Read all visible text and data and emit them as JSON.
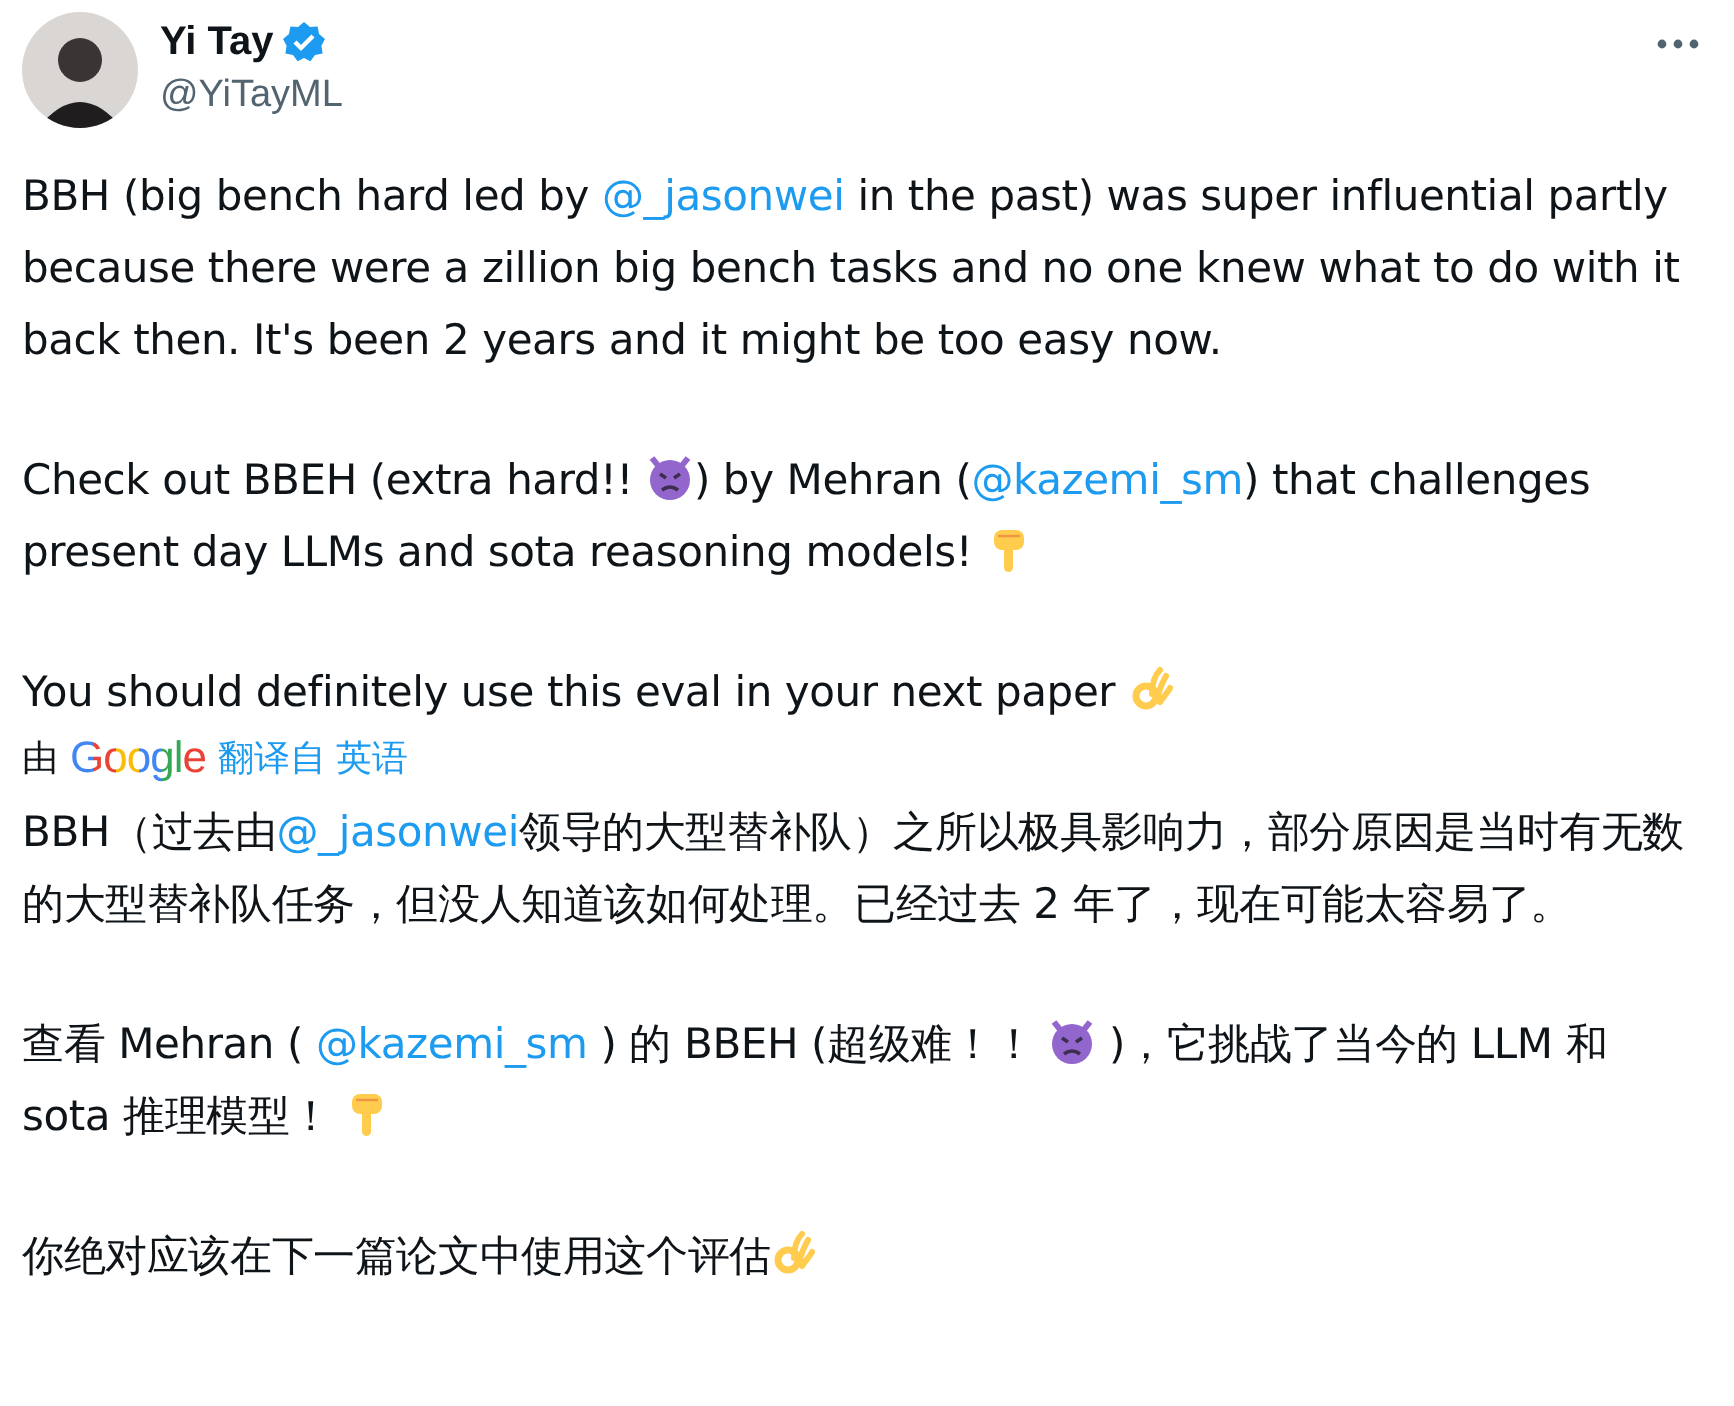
{
  "author": {
    "name": "Yi Tay",
    "handle": "@YiTayML",
    "verified": true
  },
  "original": [
    [
      {
        "kind": "text",
        "text": "BBH (big bench hard led by "
      },
      {
        "kind": "mention",
        "text": "@_jasonwei"
      },
      {
        "kind": "text",
        "text": " in the past) was super influential partly because there were a zillion big bench tasks and no one knew what to do with it back then. It's been 2 years and it might be too easy now."
      }
    ],
    [
      {
        "kind": "text",
        "text": "Check out BBEH (extra hard!! "
      },
      {
        "kind": "devil"
      },
      {
        "kind": "text",
        "text": ") by Mehran ("
      },
      {
        "kind": "mention",
        "text": "@kazemi_sm"
      },
      {
        "kind": "text",
        "text": ") that challenges present day LLMs and sota reasoning models! "
      },
      {
        "kind": "point"
      }
    ],
    [
      {
        "kind": "text",
        "text": "You should definitely use this eval in your next paper "
      },
      {
        "kind": "ok"
      }
    ]
  ],
  "translation_bar": {
    "prefix": "由",
    "brand": "Google",
    "link": "翻译自 英语"
  },
  "translation": [
    [
      {
        "kind": "text",
        "text": "BBH（过去由"
      },
      {
        "kind": "mention",
        "text": "@_jasonwei"
      },
      {
        "kind": "text",
        "text": "领导的大型替补队）之所以极具影响力，部分原因是当时有无数的大型替补队任务，但没人知道该如何处理。已经过去 2 年了，现在可能太容易了。"
      }
    ],
    [
      {
        "kind": "text",
        "text": "查看 Mehran ( "
      },
      {
        "kind": "mention",
        "text": "@kazemi_sm"
      },
      {
        "kind": "text",
        "text": " ) 的 BBEH (超级难！！ "
      },
      {
        "kind": "devil"
      },
      {
        "kind": "text",
        "text": " )，它挑战了当今的 LLM 和 sota 推理模型！ "
      },
      {
        "kind": "point"
      }
    ],
    [
      {
        "kind": "text",
        "text": "你绝对应该在下一篇论文中使用这个评估"
      },
      {
        "kind": "ok"
      }
    ]
  ]
}
